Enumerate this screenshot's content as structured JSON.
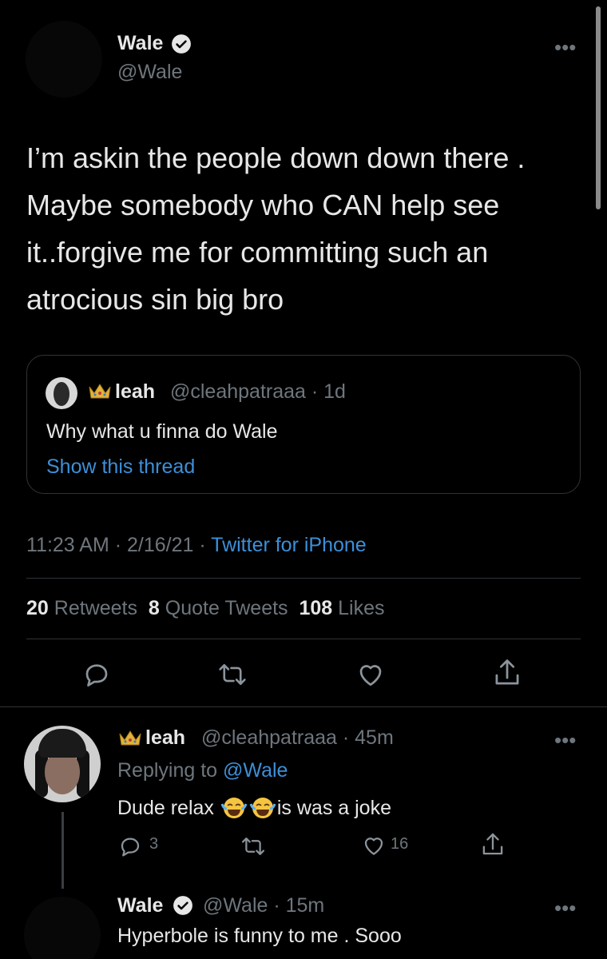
{
  "main_tweet": {
    "name": "Wale",
    "handle": "@Wale",
    "more": "•••",
    "text": "I’m askin the people down down there . Maybe somebody who CAN help see it..forgive me for committing such an atrocious sin big bro",
    "timestamp": "11:23 AM · 2/16/21 · ",
    "source": "Twitter for iPhone",
    "stats": {
      "retweets_count": "20",
      "retweets_label": "Retweets",
      "quotes_count": "8",
      "quotes_label": "Quote Tweets",
      "likes_count": "108",
      "likes_label": "Likes"
    }
  },
  "quoted_tweet": {
    "name": "leah",
    "handle_time": "@cleahpatraaa · 1d",
    "text": "Why what u finna do Wale",
    "show_thread": "Show this thread"
  },
  "replies": [
    {
      "name": "leah",
      "handle_time": "@cleahpatraaa · 45m",
      "more": "•••",
      "replying_prefix": "Replying to ",
      "replying_to": "@Wale",
      "text_before": "Dude relax ",
      "text_after": "is was a joke",
      "reply_count": "3",
      "like_count": "16"
    },
    {
      "name": "Wale",
      "handle_time": "@Wale · 15m",
      "more": "•••",
      "text": "Hyperbole is funny to me . Sooo"
    }
  ],
  "colors": {
    "background": "#000000",
    "accent": "#3d8fd8",
    "muted": "#6e767d",
    "divider": "#2f3336"
  },
  "icons": [
    "verified-badge-icon",
    "more-icon",
    "reply-icon",
    "retweet-icon",
    "like-icon",
    "share-icon",
    "crown-emoji-icon",
    "laughing-emoji-icon"
  ]
}
